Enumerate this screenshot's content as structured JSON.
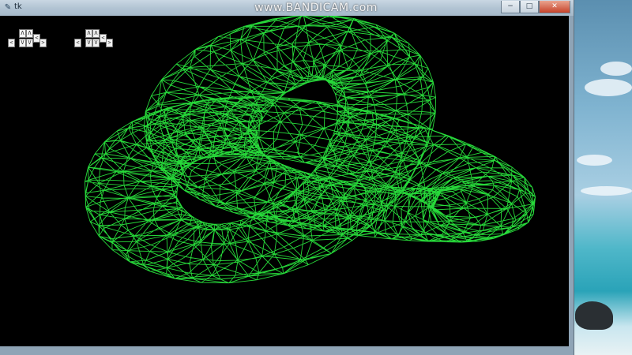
{
  "watermark": "www.BANDICAM.com",
  "window": {
    "title": "tk",
    "minimize_glyph": "−",
    "maximize_glyph": "□",
    "close_glyph": "✕"
  },
  "key_pads": [
    {
      "up": "Λ",
      "down": "V",
      "left": "<",
      "right": ">",
      "extra_left": "<",
      "extra_right": ">"
    },
    {
      "up": "Λ",
      "down": "V",
      "left": "<",
      "right": ">",
      "extra_left": "<",
      "extra_right": ">"
    }
  ],
  "colors": {
    "wireframe": "#27d93a",
    "canvas_background": "#000000"
  }
}
